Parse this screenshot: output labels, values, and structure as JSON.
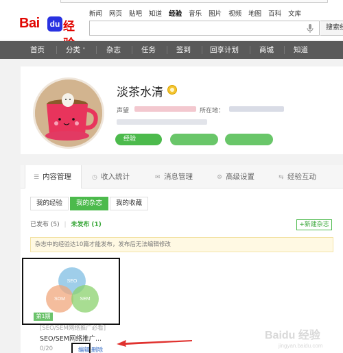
{
  "header": {
    "logo": {
      "bai": "Bai",
      "paw": "du",
      "jingyan": "经验"
    },
    "nav": [
      "新闻",
      "网页",
      "贴吧",
      "知道",
      "经验",
      "音乐",
      "图片",
      "视频",
      "地图",
      "百科",
      "文库"
    ],
    "active_nav": "经验",
    "search_value": "",
    "search_button": "搜索经"
  },
  "navbar": {
    "items": [
      "首页",
      "分类",
      "杂志",
      "任务",
      "签到",
      "回享计划",
      "商城",
      "知道"
    ],
    "dropdown_marker": "˅"
  },
  "profile": {
    "username": "淡茶水清",
    "reputation_label": "声望",
    "location_label": "所在地：",
    "experience_pill": "经验"
  },
  "tabs": [
    {
      "label": "内容管理",
      "icon": "list-icon"
    },
    {
      "label": "收入统计",
      "icon": "clock-icon"
    },
    {
      "label": "消息管理",
      "icon": "mail-icon"
    },
    {
      "label": "高级设置",
      "icon": "gear-icon"
    },
    {
      "label": "经验互动",
      "icon": "exchange-icon"
    }
  ],
  "subtabs": [
    "我的经验",
    "我的杂志",
    "我的收藏"
  ],
  "status": {
    "published_label": "已发布",
    "published_count": "(5)",
    "divider": "|",
    "unpublished_label": "未发布",
    "unpublished_count": "(1)"
  },
  "new_magazine_button": "+新建杂志",
  "notice": "杂志中的经验达10篇才能发布，发布后无法编辑修改",
  "magazine": {
    "venn_labels": [
      "SEO",
      "SOM",
      "SEM"
    ],
    "issue_badge": "第1期",
    "tag": "[SEO/SEM网络推广必看]",
    "title": "SEO/SEM网络推广...",
    "count": "0/20",
    "edit": "编辑",
    "delete": "删除"
  },
  "watermark": {
    "brand": "Baidu 经验",
    "url": "jingyan.baidu.com"
  },
  "colors": {
    "brand_red": "#e10601",
    "brand_blue": "#2932e1",
    "green": "#4cba4c",
    "navbar": "#5a5a5a",
    "notice_bg": "#fff9e3",
    "seo": "#8ec6e6",
    "som": "#f0a77c",
    "sem": "#8bd26e"
  }
}
